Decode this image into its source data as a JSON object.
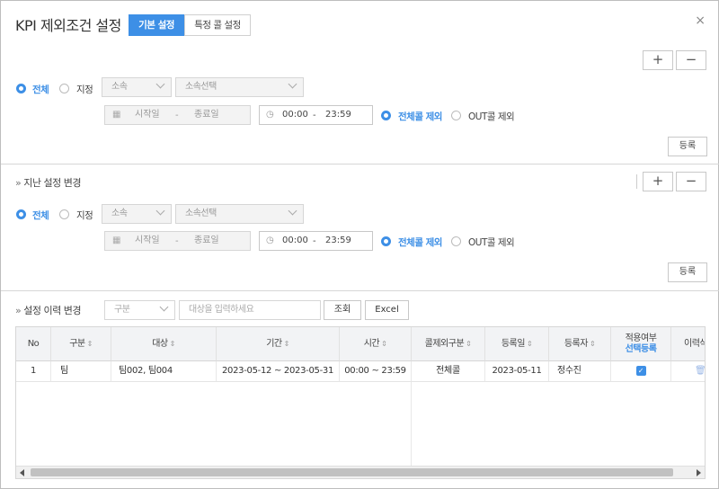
{
  "header": {
    "title": "KPI 제외조건 설정",
    "tabs": [
      {
        "label": "기본 설정",
        "active": true
      },
      {
        "label": "특정 콜 설정",
        "active": false
      }
    ],
    "close": "×"
  },
  "controls": {
    "plus": "+",
    "minus": "−"
  },
  "form1": {
    "radio_all": "전체",
    "radio_specific": "지정",
    "affiliation": "소속",
    "affiliation_select": "소속선택",
    "start_date": "시작일",
    "date_sep": "-",
    "end_date": "종료일",
    "time_start": "00:00",
    "time_sep": "-",
    "time_end": "23:59",
    "exclude_all": "전체콜 제외",
    "exclude_out": "OUT콜 제외",
    "register": "등록"
  },
  "section2": {
    "title": "지난 설정 변경",
    "radio_all": "전체",
    "radio_specific": "지정",
    "affiliation": "소속",
    "affiliation_select": "소속선택",
    "start_date": "시작일",
    "date_sep": "-",
    "end_date": "종료일",
    "time_start": "00:00",
    "time_sep": "-",
    "time_end": "23:59",
    "exclude_all": "전체콜 제외",
    "exclude_out": "OUT콜 제외",
    "register": "등록"
  },
  "section3": {
    "title": "설정 이력 변경",
    "filter": "구분",
    "target_placeholder": "대상을 입력하세요",
    "search": "조회",
    "excel": "Excel"
  },
  "table": {
    "columns": [
      "No",
      "구분",
      "대상",
      "기간",
      "시간",
      "콜제외구분",
      "등록일",
      "등록자",
      "적용여부",
      "이력삭"
    ],
    "apply_sub": "선택등록",
    "rows": [
      {
        "no": "1",
        "type": "팀",
        "target": "팀002, 팀004",
        "period": "2023-05-12 ~ 2023-05-31",
        "time": "00:00 ~ 23:59",
        "exclude": "전체콜",
        "reg_date": "2023-05-11",
        "registrant": "정수진",
        "applied": true
      }
    ]
  }
}
